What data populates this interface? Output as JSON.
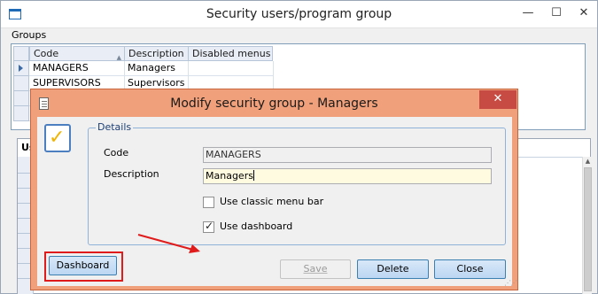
{
  "main_window": {
    "title": "Security users/program group",
    "controls": {
      "minimize": "—",
      "maximize": "☐",
      "close": "✕"
    },
    "groups_label": "Groups",
    "groups_grid": {
      "columns": [
        "Code",
        "Description",
        "Disabled menus"
      ],
      "rows": [
        {
          "code": "MANAGERS",
          "description": "Managers",
          "disabled_menus": ""
        },
        {
          "code": "SUPERVISORS",
          "description": "Supervisors",
          "disabled_menus": ""
        },
        {
          "code": "",
          "description": "",
          "disabled_menus": ""
        },
        {
          "code": "",
          "description": "",
          "disabled_menus": ""
        }
      ]
    },
    "users_tab_label": "Us"
  },
  "dialog": {
    "title": "Modify security group - Managers",
    "close_glyph": "✕",
    "details_legend": "Details",
    "code_label": "Code",
    "code_value": "MANAGERS",
    "description_label": "Description",
    "description_value": "Managers",
    "use_classic_menu_bar_label": "Use classic menu bar",
    "use_classic_menu_bar_checked": false,
    "use_dashboard_label": "Use dashboard",
    "use_dashboard_checked": true,
    "buttons": {
      "dashboard": "Dashboard",
      "save": "Save",
      "delete": "Delete",
      "close": "Close"
    }
  },
  "colors": {
    "dialog_frame": "#f0a07a",
    "dialog_close": "#c74b43",
    "highlight": "#e01b1b",
    "annotation_arrow": "#e01b1b"
  }
}
